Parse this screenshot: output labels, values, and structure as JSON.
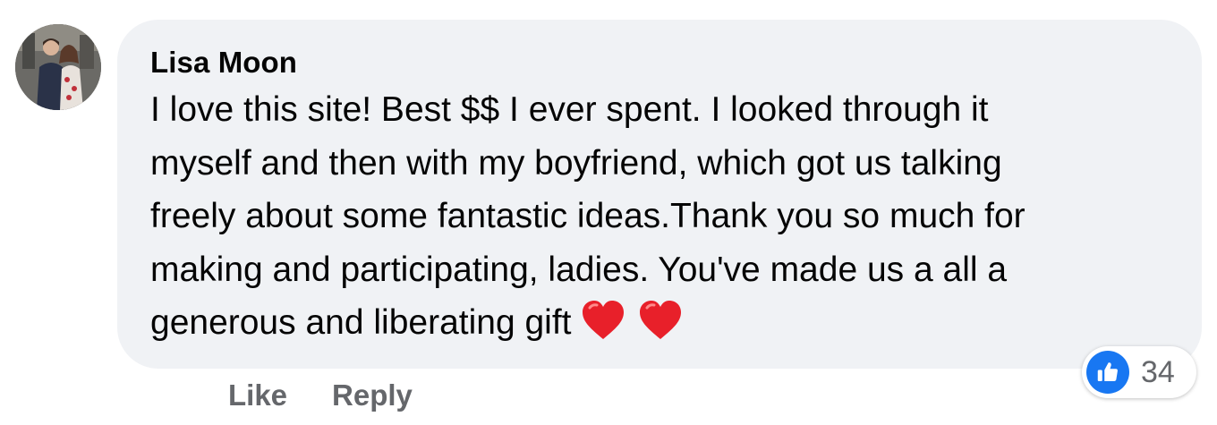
{
  "comment": {
    "author": "Lisa Moon",
    "text": "I love this site! Best $$ I ever spent. I looked through it\nmyself and then with my boyfriend, which got us talking\nfreely about some fantastic ideas.Thank you so much for\nmaking and participating, ladies. You've made us a all a\ngenerous and liberating gift",
    "emojis": [
      "red-heart",
      "red-heart"
    ]
  },
  "actions": {
    "like_label": "Like",
    "reply_label": "Reply"
  },
  "reactions": {
    "icon": "thumbs-up-icon",
    "count": "34",
    "color": "#1877f2"
  },
  "colors": {
    "bubble": "#f0f2f5",
    "text": "#050505",
    "secondary_text": "#65676b",
    "heart": "#e8202a"
  }
}
